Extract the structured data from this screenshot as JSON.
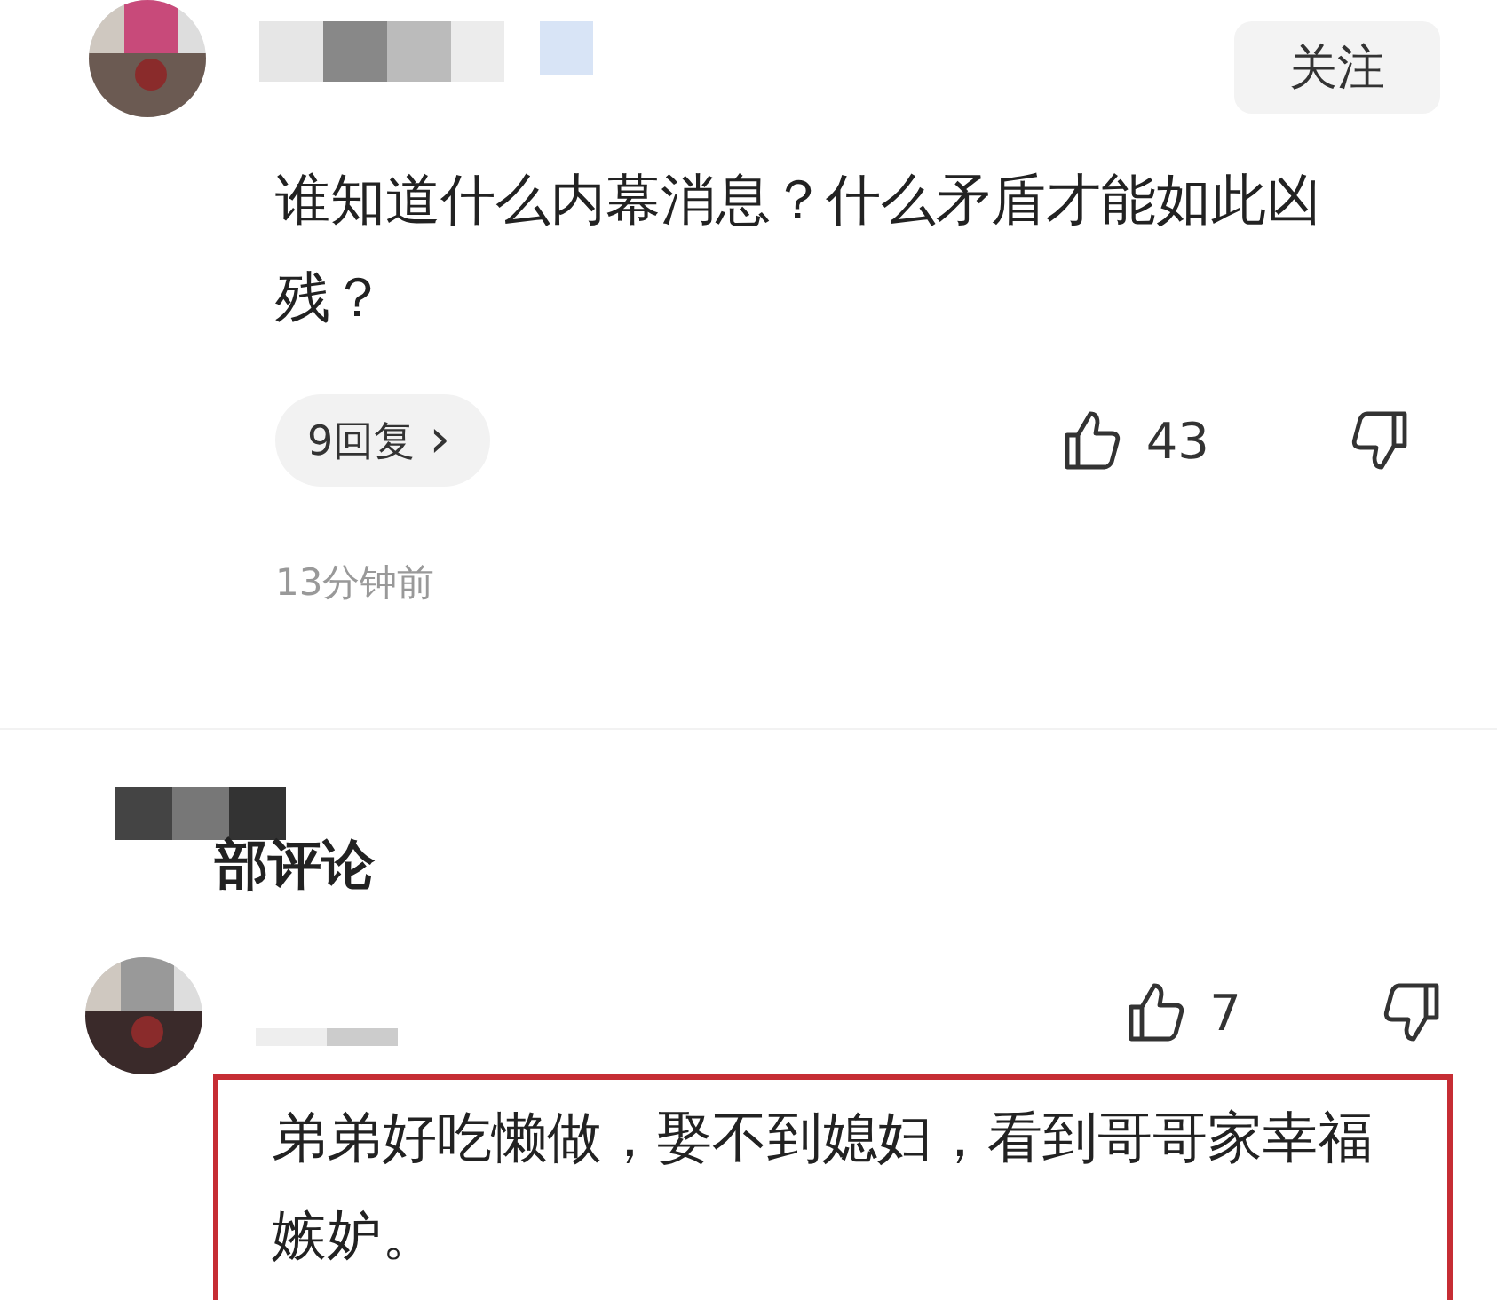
{
  "top_comment": {
    "follow_button": "关注",
    "text": "谁知道什么内幕消息？什么矛盾才能如此凶残？",
    "replies_button": "9回复",
    "reply_caret": "›",
    "likes": "43",
    "time": "13分钟前"
  },
  "section": {
    "title": "部评论"
  },
  "comment": {
    "likes": "7",
    "text": "弟弟好吃懒做，娶不到媳妇，看到哥哥家幸福嫉妒。",
    "highlighted": true
  }
}
